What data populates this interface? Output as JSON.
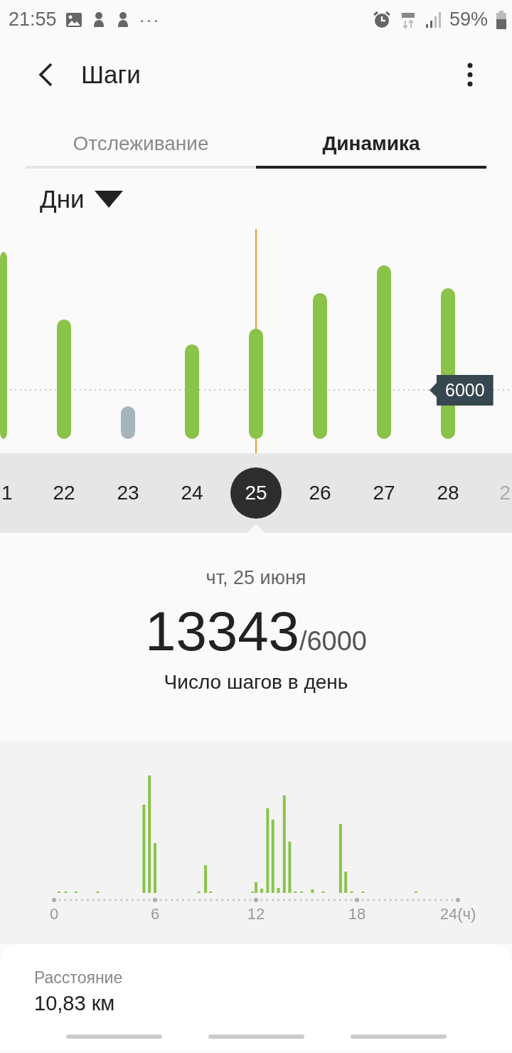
{
  "status_bar": {
    "time": "21:55",
    "more": "···",
    "battery": "59%"
  },
  "header": {
    "title": "Шаги"
  },
  "tabs": [
    {
      "label": "Отслеживание",
      "selected": false
    },
    {
      "label": "Динамика",
      "selected": true
    }
  ],
  "period_dropdown": {
    "label": "Дни"
  },
  "goal_label": "6000",
  "days": [
    {
      "label": "1",
      "selected": false
    },
    {
      "label": "22",
      "selected": false
    },
    {
      "label": "23",
      "selected": false
    },
    {
      "label": "24",
      "selected": false
    },
    {
      "label": "25",
      "selected": true
    },
    {
      "label": "26",
      "selected": false
    },
    {
      "label": "27",
      "selected": false
    },
    {
      "label": "28",
      "selected": false
    },
    {
      "label": "2",
      "selected": false
    }
  ],
  "summary": {
    "date": "чт, 25 июня",
    "steps": "13343",
    "goal": "/6000",
    "caption": "Число шагов в день"
  },
  "hourly_axis": [
    "0",
    "6",
    "12",
    "18",
    "24(ч)"
  ],
  "distance": {
    "label": "Расстояние",
    "value": "10,83 км"
  }
}
